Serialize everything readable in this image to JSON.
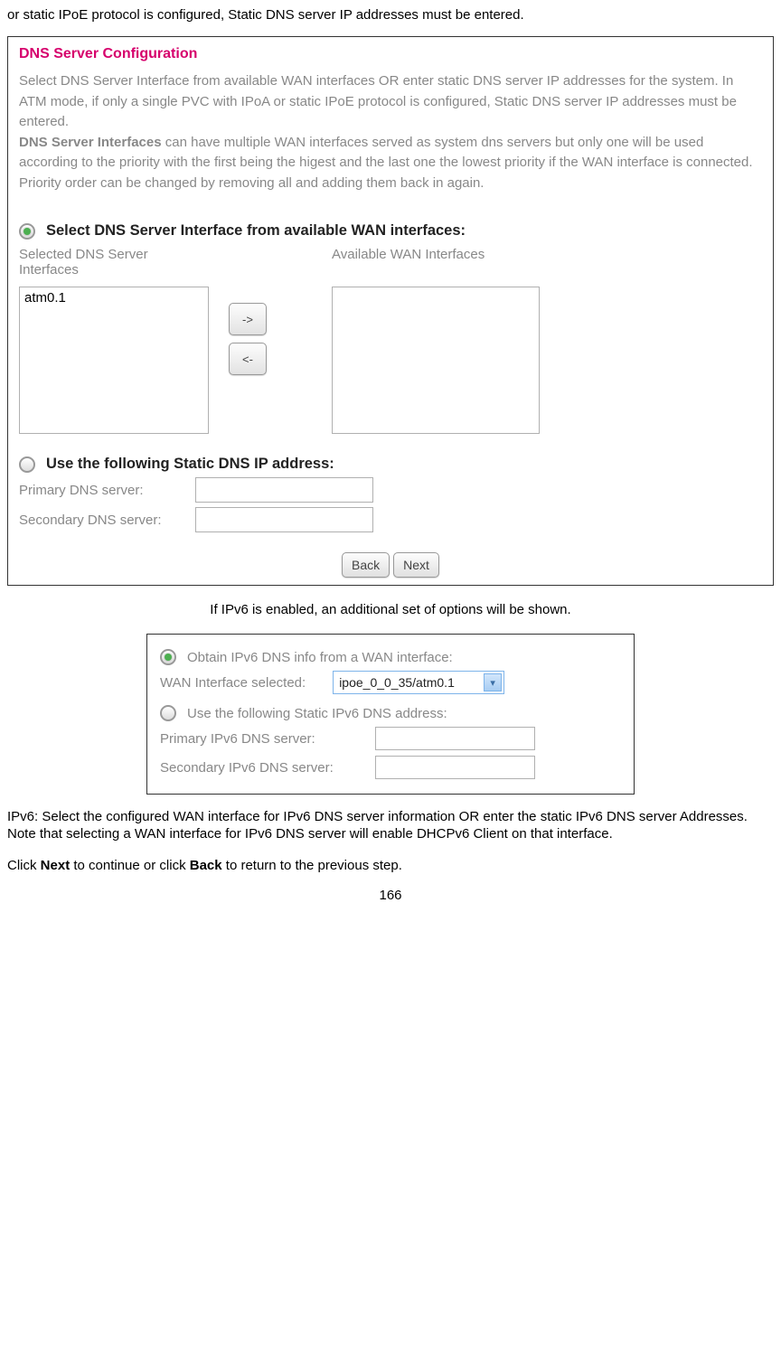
{
  "intro_text": "or static IPoE protocol is configured, Static DNS server IP addresses must be entered.",
  "panel1": {
    "title": "DNS Server Configuration",
    "desc_part1": "Select DNS Server Interface from available WAN interfaces OR enter static DNS server IP addresses for the system. In ATM mode, if only a single PVC with IPoA or static IPoE protocol is configured, Static DNS server IP addresses must be entered.",
    "desc_bold": "DNS Server Interfaces",
    "desc_part2": " can have multiple WAN interfaces served as system dns servers but only one will be used according to the priority with the first being the higest and the last one the lowest priority if the WAN interface is connected. Priority order can be changed by removing all and adding them back in again.",
    "radio1_label": "Select DNS Server Interface from available WAN interfaces:",
    "selected_header": "Selected DNS Server Interfaces",
    "available_header": "Available WAN Interfaces",
    "selected_item": "atm0.1",
    "arrow_right": "->",
    "arrow_left": "<-",
    "radio2_label": "Use the following Static DNS IP address:",
    "primary_label": "Primary DNS server:",
    "secondary_label": "Secondary DNS server:",
    "back_btn": "Back",
    "next_btn": "Next"
  },
  "caption1": "If IPv6 is enabled, an additional set of options will be shown.",
  "panel2": {
    "radio1_label": "Obtain IPv6 DNS info from a WAN interface:",
    "wan_label": "WAN Interface selected:",
    "wan_value": "ipoe_0_0_35/atm0.1",
    "radio2_label": "Use the following Static IPv6 DNS address:",
    "primary_label": "Primary IPv6 DNS server:",
    "secondary_label": "Secondary IPv6 DNS server:"
  },
  "footer": {
    "line1": "IPv6: Select the configured WAN interface for IPv6 DNS server information OR enter the static IPv6 DNS server Addresses.",
    "line2": "Note that selecting a WAN interface for IPv6 DNS server will enable DHCPv6 Client on that interface.",
    "line3a": "Click ",
    "line3_next": "Next",
    "line3b": " to continue or click ",
    "line3_back": "Back",
    "line3c": " to return to the previous step."
  },
  "page_num": "166"
}
